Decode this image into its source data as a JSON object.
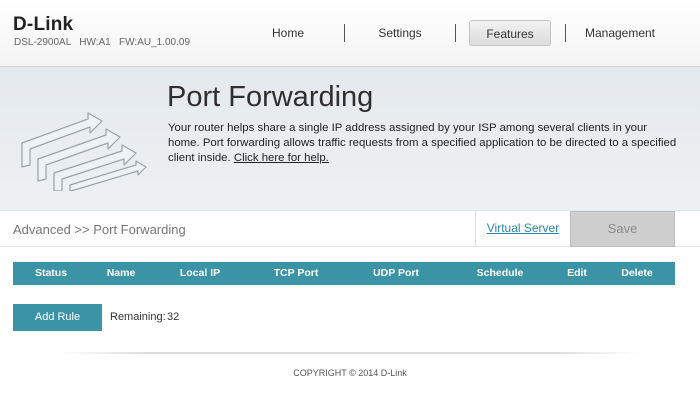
{
  "header": {
    "brand": "D-Link",
    "model_line": "DSL-2900AL   HW:A1   FW:AU_1.00.09",
    "nav": [
      "Home",
      "Settings",
      "Features",
      "Management"
    ],
    "active_nav": "Features"
  },
  "banner": {
    "title": "Port Forwarding",
    "description": "Your router helps share a single IP address assigned by your ISP among several clients in your home. Port forwarding allows traffic requests from a specified application to be directed to a specified client inside. ",
    "help_link": "Click here for help."
  },
  "breadcrumb": "Advanced >> Port Forwarding",
  "actions": {
    "virtual_server": "Virtual Server",
    "save": "Save"
  },
  "table": {
    "headers": [
      "Status",
      "Name",
      "Local IP",
      "TCP Port",
      "UDP Port",
      "Schedule",
      "Edit",
      "Delete"
    ],
    "rows": []
  },
  "add_rule": {
    "button": "Add Rule",
    "remaining_label": "Remaining:",
    "remaining_value": "32"
  },
  "footer": {
    "copyright": "COPYRIGHT © 2014 D-Link"
  },
  "colors": {
    "accent": "#3b93a6",
    "link": "#2e84a6",
    "save_disabled": "#cfcfcf"
  }
}
